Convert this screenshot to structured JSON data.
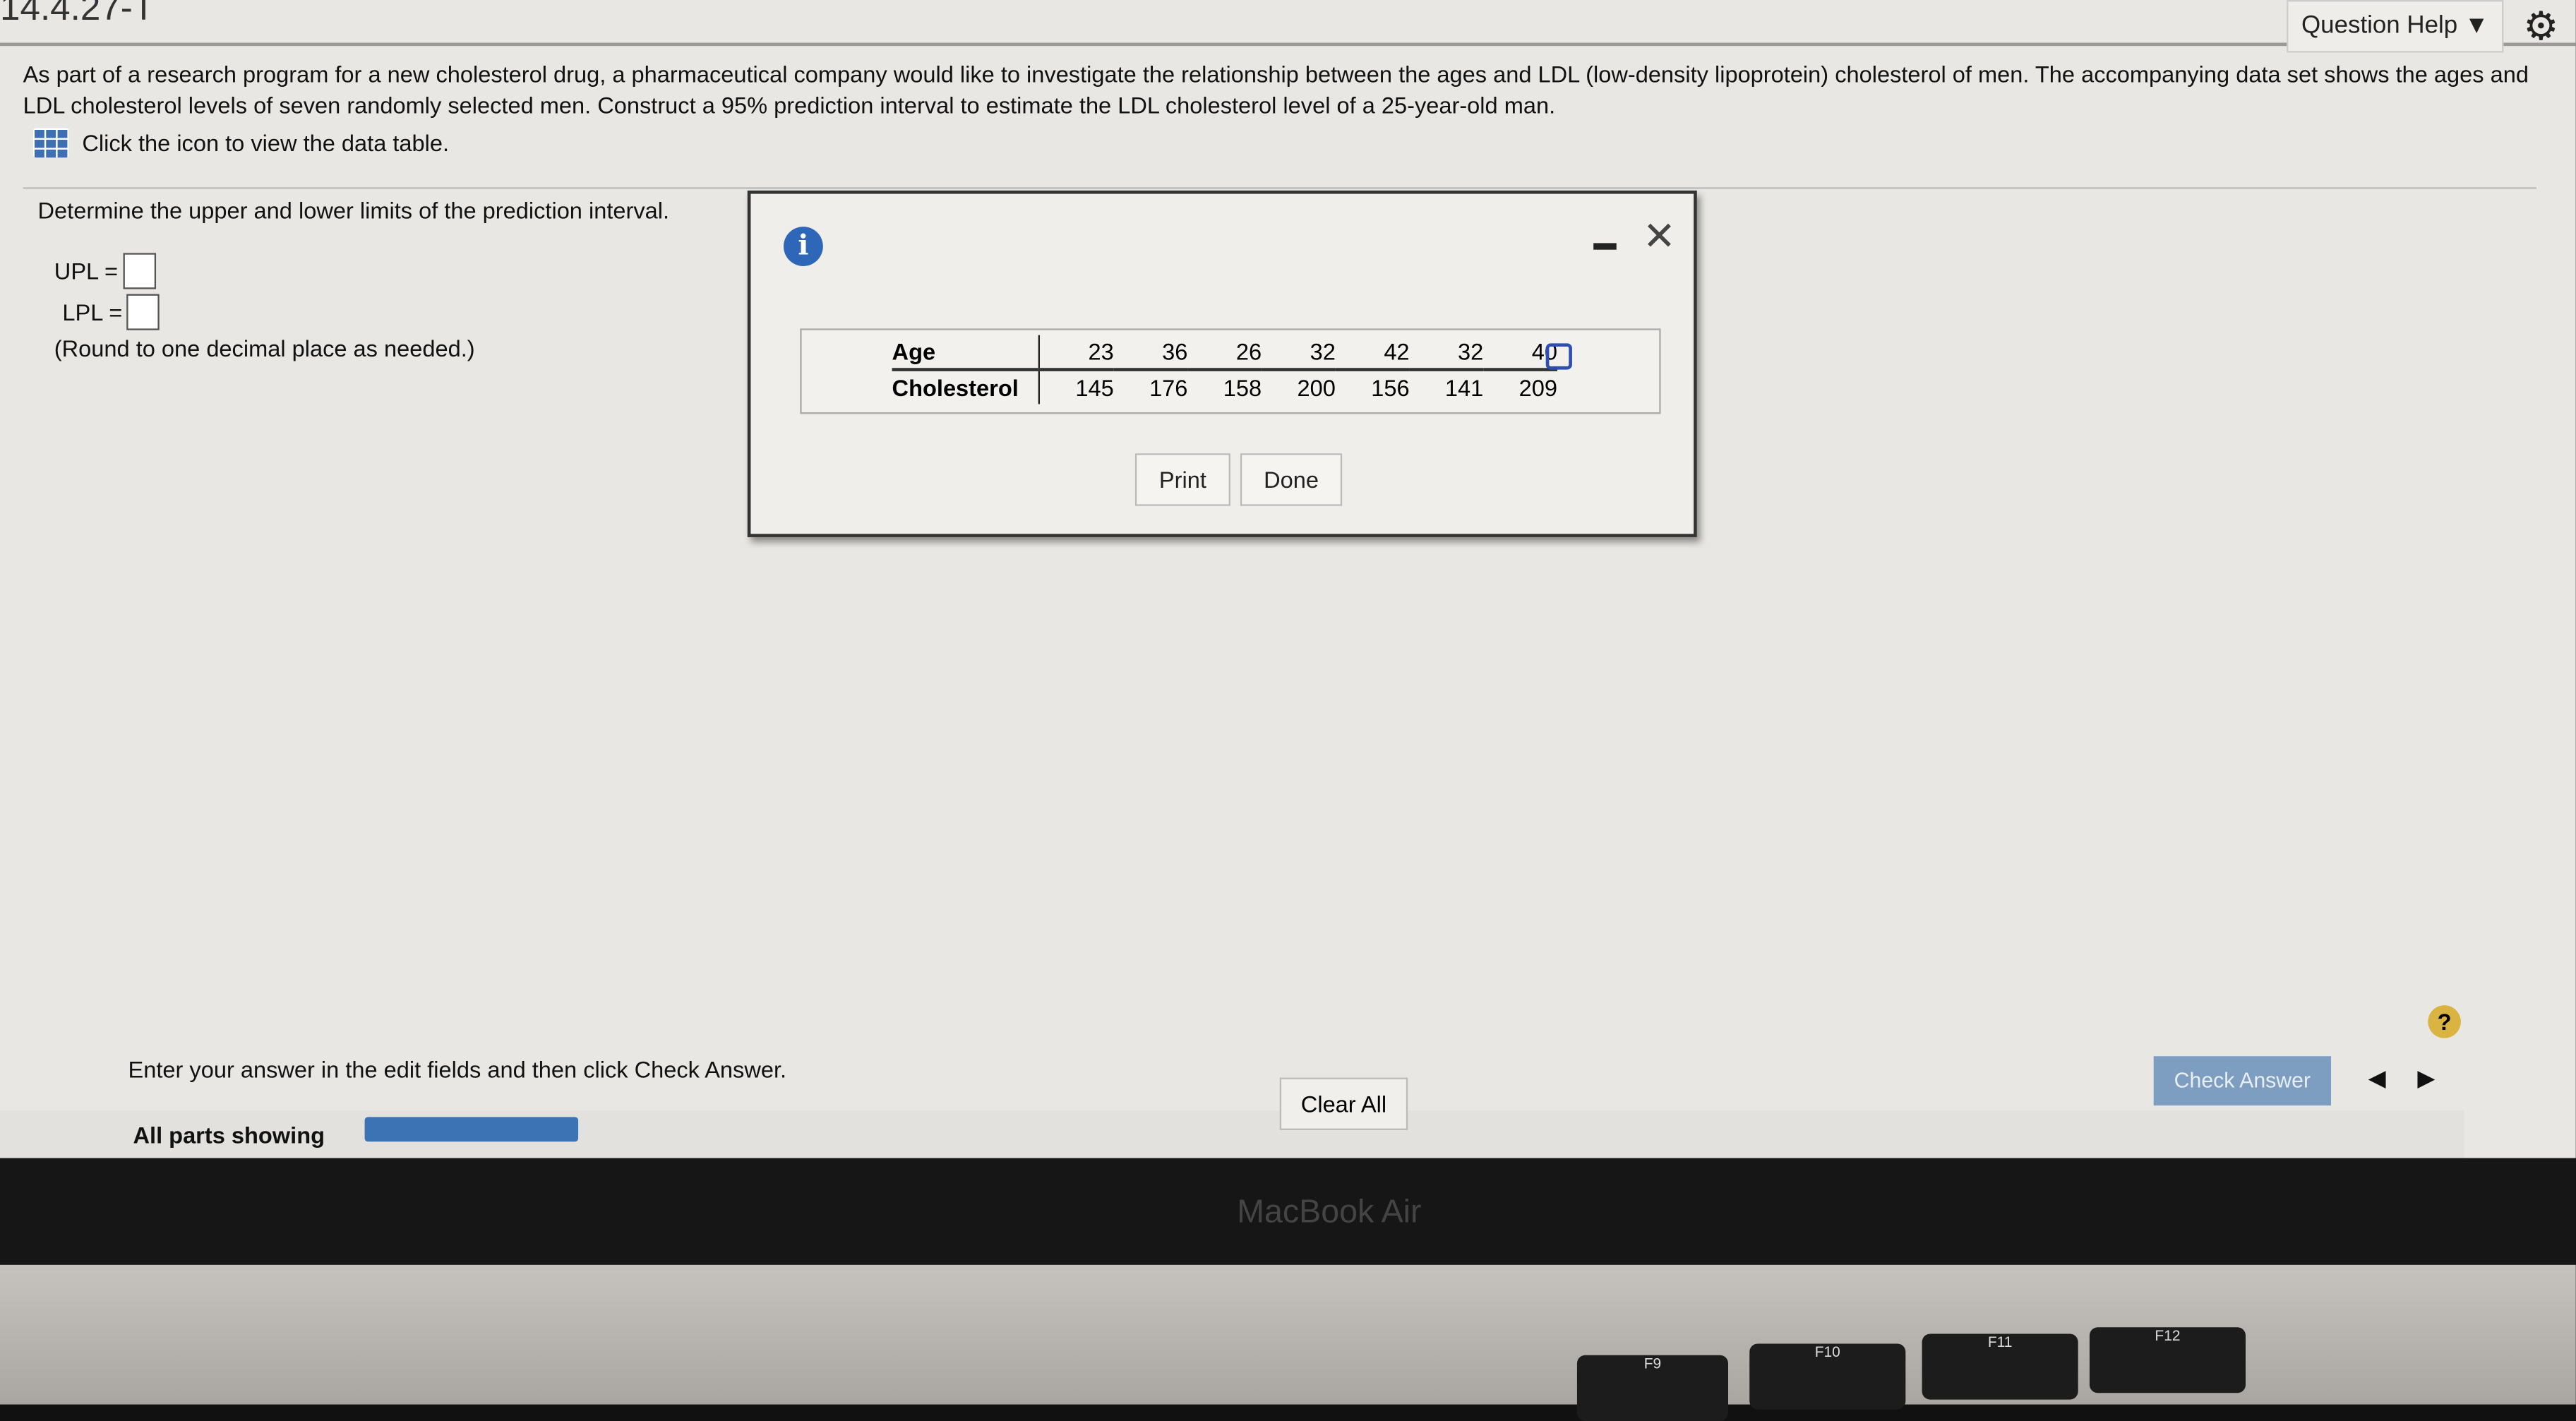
{
  "header": {
    "question_number": "14.4.27-T",
    "question_help": "Question Help ▼",
    "settings_icon": "gear-icon"
  },
  "intro": "As part of a research program for a new cholesterol drug, a pharmaceutical company would like to investigate the relationship between the ages and LDL (low-density lipoprotein) cholesterol of men. The accompanying data set shows the ages and LDL cholesterol levels of seven randomly selected men. Construct a 95% prediction interval to estimate the LDL cholesterol level of a 25-year-old man.",
  "data_table_link": "Click the icon to view the data table.",
  "question": {
    "prompt": "Determine the upper and lower limits of the prediction interval.",
    "upl_label": "UPL =",
    "lpl_label": "LPL =",
    "upl_value": "",
    "lpl_value": "",
    "round_note": "(Round to one decimal place as needed.)"
  },
  "modal": {
    "table": {
      "rows": [
        {
          "label": "Age",
          "values": [
            "23",
            "36",
            "26",
            "32",
            "42",
            "32",
            "40"
          ]
        },
        {
          "label": "Cholesterol",
          "values": [
            "145",
            "176",
            "158",
            "200",
            "156",
            "141",
            "209"
          ]
        }
      ]
    },
    "print_label": "Print",
    "done_label": "Done"
  },
  "footer": {
    "instruction": "Enter your answer in the edit fields and then click Check Answer.",
    "check_answer": "Check Answer",
    "clear_all": "Clear All",
    "all_parts": "All parts showing",
    "help": "?",
    "prev": "◀",
    "next": "▶"
  },
  "device": {
    "brand": "MacBook Air",
    "keys": [
      "F9",
      "F10",
      "F11",
      "F12"
    ]
  },
  "colors": {
    "accent": "#3c73b5",
    "check_answer_bg": "#7d9ec0"
  }
}
